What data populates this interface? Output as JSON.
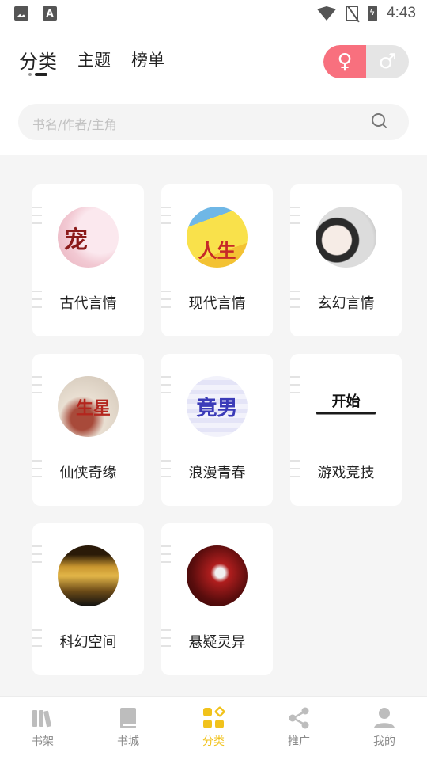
{
  "status_bar": {
    "time": "4:43"
  },
  "header": {
    "tabs": [
      {
        "label": "分类",
        "active": true
      },
      {
        "label": "主题",
        "active": false
      },
      {
        "label": "榜单",
        "active": false
      }
    ],
    "gender_toggle": {
      "female_symbol": "♀",
      "male_symbol": "♂",
      "selected": "female"
    }
  },
  "search": {
    "placeholder": "书名/作者/主角",
    "icon": "search-icon"
  },
  "categories": [
    {
      "label": "古代言情",
      "icon": "cover-ancient-romance",
      "glyph": "宠"
    },
    {
      "label": "现代言情",
      "icon": "cover-modern-romance",
      "glyph": "人生"
    },
    {
      "label": "玄幻言情",
      "icon": "cover-fantasy-romance",
      "glyph": ""
    },
    {
      "label": "仙侠奇缘",
      "icon": "cover-xianxia",
      "glyph": "生星"
    },
    {
      "label": "浪漫青春",
      "icon": "cover-youth",
      "glyph": "竟男"
    },
    {
      "label": "游戏竞技",
      "icon": "cover-gaming",
      "glyph": "开始"
    },
    {
      "label": "科幻空间",
      "icon": "cover-scifi",
      "glyph": ""
    },
    {
      "label": "悬疑灵异",
      "icon": "cover-mystery",
      "glyph": ""
    }
  ],
  "bottom_nav": [
    {
      "label": "书架",
      "icon": "bookshelf-icon",
      "active": false
    },
    {
      "label": "书城",
      "icon": "book-icon",
      "active": false
    },
    {
      "label": "分类",
      "icon": "category-grid-icon",
      "active": true
    },
    {
      "label": "推广",
      "icon": "share-icon",
      "active": false
    },
    {
      "label": "我的",
      "icon": "profile-icon",
      "active": false
    }
  ],
  "colors": {
    "accent": "#f1c21b",
    "female": "#f8707e",
    "inactive": "#8a8a8a"
  }
}
